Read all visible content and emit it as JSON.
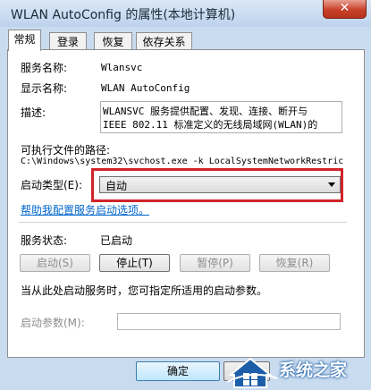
{
  "window": {
    "title": "WLAN AutoConfig 的属性(本地计算机)",
    "close_label": "✕"
  },
  "tabs": [
    {
      "label": "常规",
      "active": true
    },
    {
      "label": "登录",
      "active": false
    },
    {
      "label": "恢复",
      "active": false
    },
    {
      "label": "依存关系",
      "active": false
    }
  ],
  "general": {
    "service_name_label": "服务名称:",
    "service_name_value": "Wlansvc",
    "display_name_label": "显示名称:",
    "display_name_value": "WLAN AutoConfig",
    "description_label": "描述:",
    "description_lines": [
      "WLANSVC 服务提供配置、发现、连接、断开与",
      "IEEE 802.11 标准定义的无线局域网(WLAN)的"
    ],
    "exe_path_label": "可执行文件的路径:",
    "exe_path_value": "C:\\Windows\\system32\\svchost.exe -k LocalSystemNetworkRestric",
    "startup_type_label": "启动类型(E):",
    "startup_type_value": "自动",
    "help_link": "帮助我配置服务启动选项。",
    "service_status_label": "服务状态:",
    "service_status_value": "已启动",
    "buttons": {
      "start": "启动(S)",
      "stop": "停止(T)",
      "pause": "暂停(P)",
      "resume": "恢复(R)"
    },
    "hint_text": "当从此处启动服务时，您可指定所适用的启动参数。",
    "start_params_label": "启动参数(M):",
    "start_params_value": ""
  },
  "footer": {
    "ok_label": "确定"
  },
  "watermark": {
    "text": "系统之家"
  },
  "colors": {
    "highlight": "#d0232a",
    "link": "#0066cc",
    "watermark": "#1c5fa8"
  }
}
